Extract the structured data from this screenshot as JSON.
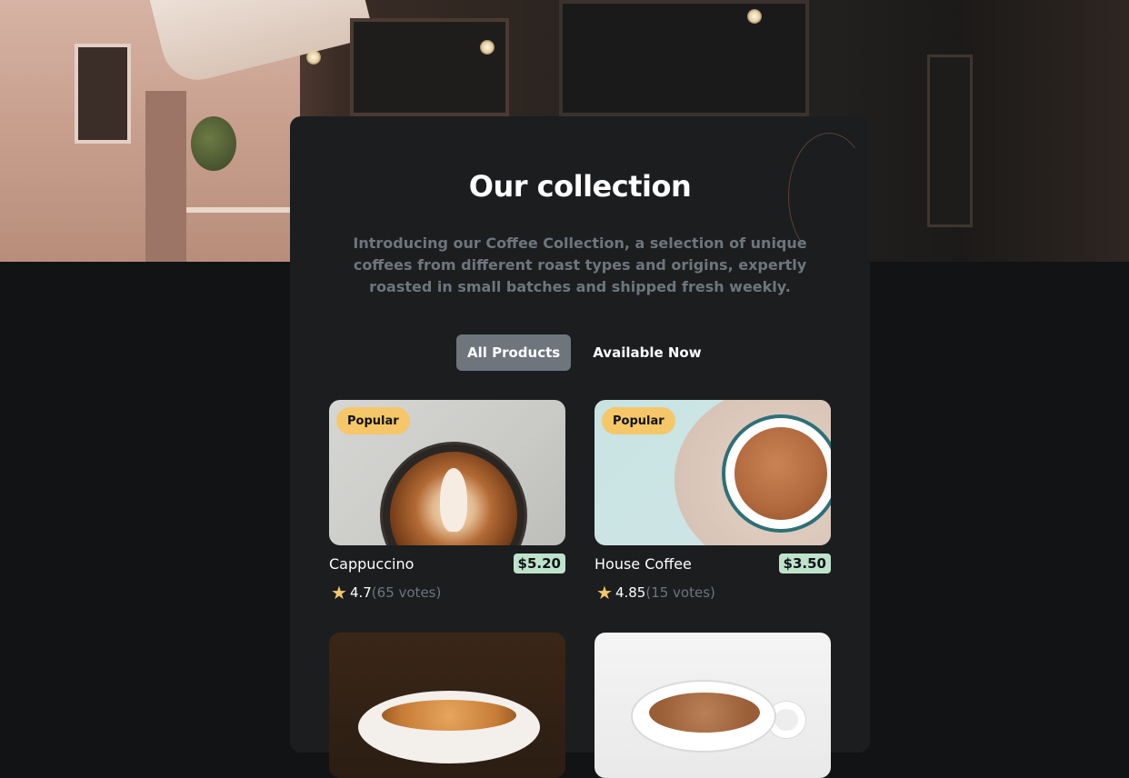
{
  "page": {
    "title": "Our collection",
    "subtitle": "Introducing our Coffee Collection, a selection of unique coffees from different roast types and origins, expertly roasted in small batches and shipped fresh weekly."
  },
  "tabs": [
    {
      "label": "All Products",
      "active": true
    },
    {
      "label": "Available Now",
      "active": false
    }
  ],
  "products": [
    {
      "name": "Cappuccino",
      "price": "$5.20",
      "badge": "Popular",
      "rating": "4.7",
      "votes": "(65 votes)",
      "image": "cappuccino"
    },
    {
      "name": "House Coffee",
      "price": "$3.50",
      "badge": "Popular",
      "rating": "4.85",
      "votes": "(15 votes)",
      "image": "house-coffee"
    },
    {
      "image": "espresso"
    },
    {
      "image": "latte"
    }
  ],
  "colors": {
    "background": "#111315",
    "panel": "#1b1d1f",
    "text": "#fefefe",
    "muted": "#6f757c",
    "badge": "#f6c768",
    "price": "#bee3cc",
    "tab_active": "#6f757c"
  }
}
